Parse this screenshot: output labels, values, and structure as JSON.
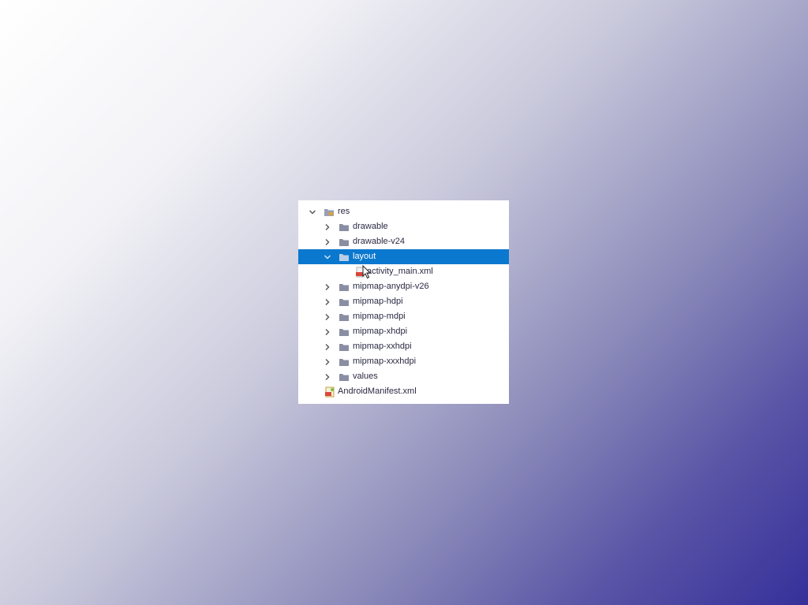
{
  "tree": {
    "rows": [
      {
        "label": "res"
      },
      {
        "label": "drawable"
      },
      {
        "label": "drawable-v24"
      },
      {
        "label": "layout"
      },
      {
        "label": "activity_main.xml"
      },
      {
        "label": "mipmap-anydpi-v26"
      },
      {
        "label": "mipmap-hdpi"
      },
      {
        "label": "mipmap-mdpi"
      },
      {
        "label": "mipmap-xhdpi"
      },
      {
        "label": "mipmap-xxhdpi"
      },
      {
        "label": "mipmap-xxxhdpi"
      },
      {
        "label": "values"
      },
      {
        "label": "AndroidManifest.xml"
      }
    ],
    "selected_label": "layout"
  },
  "colors": {
    "selection": "#0b78cf",
    "folder": "#8a8ea3",
    "text": "#2a2a44",
    "gradient_dark": "#35309a"
  },
  "icons": {
    "expanded": "chevron-down-icon",
    "collapsed": "chevron-right-icon",
    "folder": "folder-icon",
    "res_folder": "resource-folder-icon",
    "xml_file": "xml-file-icon",
    "manifest_file": "manifest-file-icon",
    "cursor": "mouse-cursor-icon"
  }
}
